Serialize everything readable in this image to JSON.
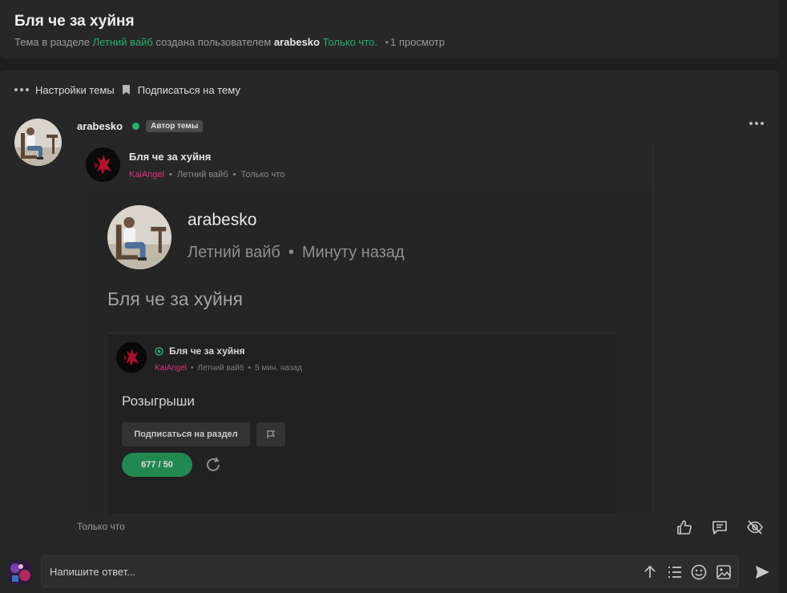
{
  "thread": {
    "title": "Бля че за хуйня",
    "meta_prefix": "Тема в разделе",
    "section": "Летний вайб",
    "meta_middle": "создана пользователем",
    "author": "arabesko",
    "created": "Только что.",
    "views": "1 просмотр"
  },
  "toolbar": {
    "settings_label": "Настройки темы",
    "subscribe_label": "Подписаться на тему"
  },
  "post": {
    "author": "arabesko",
    "badge": "Автор темы",
    "time": "Только что",
    "quote": {
      "title": "Бля че за хуйня",
      "user": "KaiAngel",
      "section": "Летний вайб",
      "time": "Только что"
    },
    "screenshot": {
      "author": "arabesko",
      "section": "Летний вайб",
      "time": "Минуту назад",
      "title": "Бля че за хуйня",
      "inner": {
        "title": "Бля че за хуйня",
        "user": "KaiAngel",
        "section": "Летний вайб",
        "time": "5 мин. назад",
        "heading": "Розыгрыши",
        "subscribe_label": "Подписаться на раздел",
        "counter": "677 / 50"
      }
    }
  },
  "reply": {
    "placeholder": "Напишите ответ..."
  },
  "colors": {
    "accent_green": "#2bad72",
    "username_pink": "#e0307c",
    "background": "#1f1f1f",
    "card": "#272727"
  }
}
